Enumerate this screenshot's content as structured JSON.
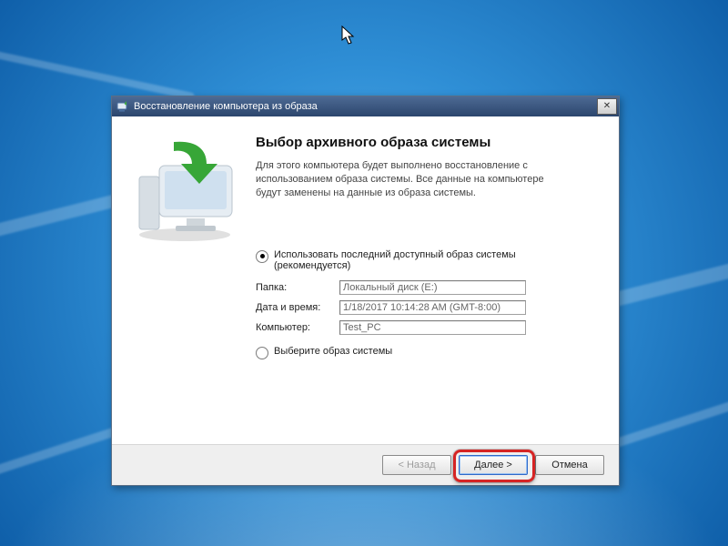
{
  "window": {
    "title": "Восстановление компьютера из образа",
    "close_glyph": "✕"
  },
  "content": {
    "heading": "Выбор архивного образа системы",
    "description": "Для этого компьютера будет выполнено восстановление с использованием образа системы. Все данные на компьютере будут заменены на данные из образа системы."
  },
  "options": {
    "use_latest": {
      "label": "Использовать последний доступный образ системы (рекомендуется)",
      "checked": true
    },
    "select_image": {
      "label": "Выберите образ системы",
      "checked": false
    }
  },
  "fields": {
    "folder": {
      "label": "Папка:",
      "value": "Локальный диск (E:)"
    },
    "datetime": {
      "label": "Дата и время:",
      "value": "1/18/2017 10:14:28 AM (GMT-8:00)"
    },
    "computer": {
      "label": "Компьютер:",
      "value": "Test_PC"
    }
  },
  "buttons": {
    "back": "< Назад",
    "next": "Далее >",
    "cancel": "Отмена"
  }
}
